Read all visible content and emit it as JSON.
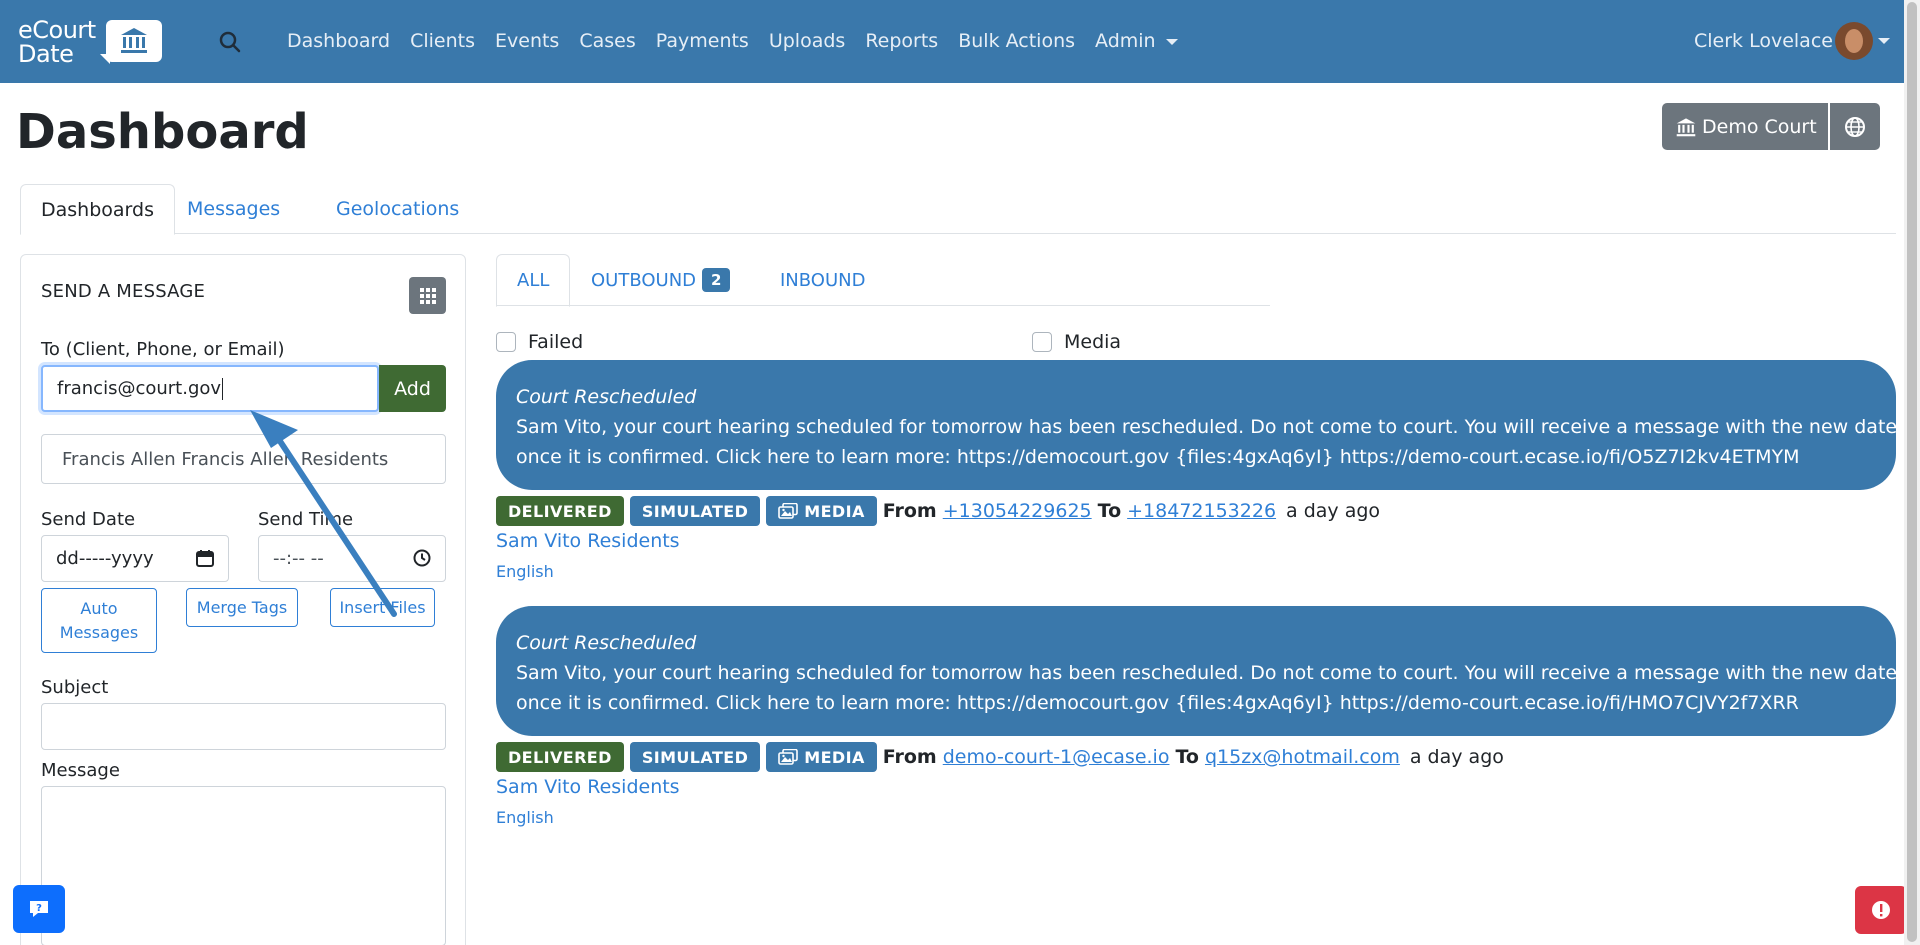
{
  "nav": {
    "logo_line1": "eCourt",
    "logo_line2": "Date",
    "links": [
      "Dashboard",
      "Clients",
      "Events",
      "Cases",
      "Payments",
      "Uploads",
      "Reports",
      "Bulk Actions",
      "Admin"
    ],
    "user_name": "Clerk Lovelace"
  },
  "header": {
    "title": "Dashboard",
    "court_label": "Demo Court"
  },
  "main_tabs": [
    "Dashboards",
    "Messages",
    "Geolocations"
  ],
  "send_message": {
    "title": "SEND A MESSAGE",
    "to_label": "To (Client, Phone, or Email)",
    "to_value": "francis@court.gov",
    "add_label": "Add",
    "suggestion": "Francis Allen Francis Allen Residents",
    "send_date_label": "Send Date",
    "send_date_value": "dd-----yyyy",
    "send_time_label": "Send Time",
    "send_time_value": "--:-- --",
    "auto_messages_label": "Auto Messages",
    "merge_tags_label": "Merge Tags",
    "insert_files_label": "Insert Files",
    "subject_label": "Subject",
    "message_label": "Message"
  },
  "sub_tabs": {
    "all": "ALL",
    "outbound": "OUTBOUND",
    "outbound_count": "2",
    "inbound": "INBOUND"
  },
  "filters": {
    "failed": "Failed",
    "media": "Media"
  },
  "messages": [
    {
      "subject": "Court Rescheduled",
      "body_line1": "Sam Vito, your court hearing scheduled for tomorrow has been rescheduled. Do not come to court. You will receive a message with the new date and time",
      "body_line2": "once it is confirmed. Click here to learn more: https://democourt.gov {files:4gxAq6yI} https://demo-court.ecase.io/fi/O5Z7I2kv4ETMYM",
      "status": "DELIVERED",
      "mode": "SIMULATED",
      "media": "MEDIA",
      "from_label": "From",
      "from": "+13054229625",
      "to_label": "To",
      "to": "+18472153226",
      "time": "a day ago",
      "group": "Sam Vito Residents",
      "language": "English"
    },
    {
      "subject": "Court Rescheduled",
      "body_line1": "Sam Vito, your court hearing scheduled for tomorrow has been rescheduled. Do not come to court. You will receive a message with the new date and time",
      "body_line2": "once it is confirmed. Click here to learn more: https://democourt.gov {files:4gxAq6yI} https://demo-court.ecase.io/fi/HMO7CJVY2f7XRR",
      "status": "DELIVERED",
      "mode": "SIMULATED",
      "media": "MEDIA",
      "from_label": "From",
      "from": "demo-court-1@ecase.io",
      "to_label": "To",
      "to": "q15zx@hotmail.com",
      "time": "a day ago",
      "group": "Sam Vito Residents",
      "language": "English"
    }
  ],
  "colors": {
    "navbar": "#3a78ab",
    "delivered": "#3f6a33",
    "link": "#2f7fd6",
    "annotation_arrow": "#3a7fbf"
  }
}
